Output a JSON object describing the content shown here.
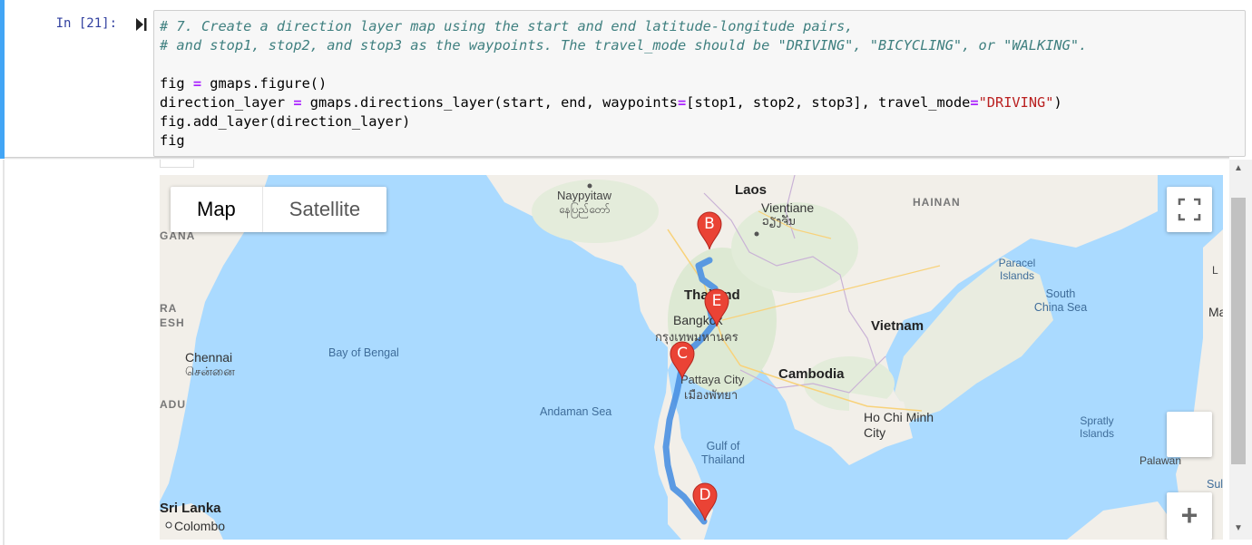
{
  "cell": {
    "prompt": "In [21]:",
    "code_lines": {
      "l1": "# 7. Create a direction layer map using the start and end latitude-longitude pairs,",
      "l2": "# and stop1, stop2, and stop3 as the waypoints. The travel_mode should be \"DRIVING\", \"BICYCLING\", or \"WALKING\".",
      "l3": "",
      "l4a": "fig ",
      "l4b": "=",
      "l4c": " gmaps.figure()",
      "l5a": "direction_layer ",
      "l5b": "=",
      "l5c": " gmaps.directions_layer(start, end, waypoints",
      "l5d": "=",
      "l5e": "[stop1, stop2, stop3], travel_mode",
      "l5f": "=",
      "l5g": "\"DRIVING\"",
      "l5h": ")",
      "l6": "fig.add_layer(direction_layer)",
      "l7": "fig"
    }
  },
  "map": {
    "controls": {
      "map_label": "Map",
      "satellite_label": "Satellite",
      "zoom_in_label": "+"
    },
    "labels": {
      "naypyitaw": "Naypyitaw",
      "naypyitaw_local": "နေပြည်တော်",
      "laos": "Laos",
      "vientiane": "Vientiane",
      "vientiane_local": "ວຽງຈັນ",
      "hainan": "HAINAN",
      "gana": "GANA",
      "ra": "RA",
      "esh": "ESH",
      "adu": "ADU",
      "thailand": "Thailand",
      "bangkok": "Bangkok",
      "bangkok_local": "กรุงเทพมหานคร",
      "vietnam": "Vietnam",
      "cambodia": "Cambodia",
      "chennai": "Chennai",
      "chennai_local": "சென்னை",
      "bay_of_bengal": "Bay of Bengal",
      "andaman_sea": "Andaman Sea",
      "pattaya": "Pattaya City",
      "pattaya_local": "เมืองพัทยา",
      "ho_chi_minh": "Ho Chi Minh City",
      "gulf_of_thailand": "Gulf of Thailand",
      "paracel": "Paracel Islands",
      "south_china_sea": "South China Sea",
      "spratly": "Spratly Islands",
      "palawan": "Palawan",
      "sri_lanka": "Sri Lanka",
      "colombo": "Colombo",
      "ma": "Ma",
      "su": "Sul",
      "l_edge": "L"
    },
    "markers": [
      "B",
      "E",
      "C",
      "D"
    ],
    "colors": {
      "water": "#aadaff",
      "land": "#f2efe9",
      "route": "#4a90e2",
      "marker": "#ea4335"
    }
  }
}
